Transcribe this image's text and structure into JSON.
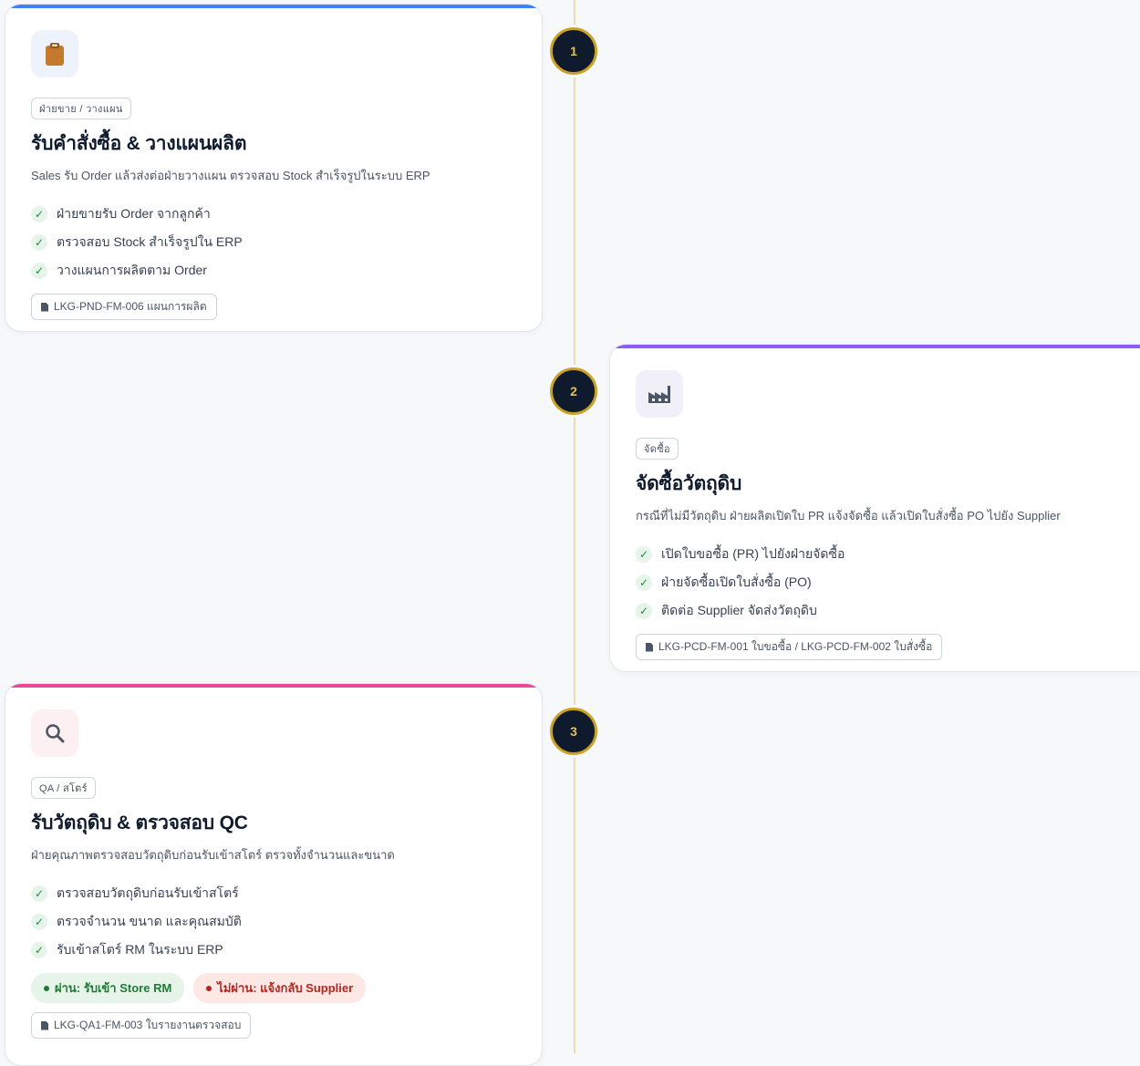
{
  "steps": [
    {
      "number": "1",
      "icon": "clipboard-icon",
      "accent": "#3b82f6",
      "department": "ฝ่ายขาย / วางแผน",
      "title": "รับคำสั่งซื้อ & วางแผนผลิต",
      "description": "Sales รับ Order แล้วส่งต่อฝ่ายวางแผน ตรวจสอบ Stock สำเร็จรูปในระบบ ERP",
      "checklist": [
        "ฝ่ายขายรับ Order จากลูกค้า",
        "ตรวจสอบ Stock สำเร็จรูปใน ERP",
        "วางแผนการผลิตตาม Order"
      ],
      "document": "LKG-PND-FM-006 แผนการผลิต"
    },
    {
      "number": "2",
      "icon": "factory-icon",
      "accent": "#8b5cf6",
      "department": "จัดซื้อ",
      "title": "จัดซื้อวัตถุดิบ",
      "description": "กรณีที่ไม่มีวัตถุดิบ ฝ่ายผลิตเปิดใบ PR แจ้งจัดซื้อ แล้วเปิดใบสั่งซื้อ PO ไปยัง Supplier",
      "checklist": [
        "เปิดใบขอซื้อ (PR) ไปยังฝ่ายจัดซื้อ",
        "ฝ่ายจัดซื้อเปิดใบสั่งซื้อ (PO)",
        "ติดต่อ Supplier จัดส่งวัตถุดิบ"
      ],
      "document": "LKG-PCD-FM-001 ใบขอซื้อ / LKG-PCD-FM-002 ใบสั่งซื้อ"
    },
    {
      "number": "3",
      "icon": "magnifier-icon",
      "accent": "#ec4899",
      "department": "QA / สโตร์",
      "title": "รับวัตถุดิบ & ตรวจสอบ QC",
      "description": "ฝ่ายคุณภาพตรวจสอบวัตถุดิบก่อนรับเข้าสโตร์ ตรวจทั้งจำนวนและขนาด",
      "checklist": [
        "ตรวจสอบวัตถุดิบก่อนรับเข้าสโตร์",
        "ตรวจจำนวน ขนาด และคุณสมบัติ",
        "รับเข้าสโตร์ RM ในระบบ ERP"
      ],
      "outcomes": {
        "pass": "ผ่าน: รับเข้า Store RM",
        "fail": "ไม่ผ่าน: แจ้งกลับ Supplier"
      },
      "document": "LKG-QA1-FM-003 ใบรายงานตรวจสอบ"
    }
  ]
}
